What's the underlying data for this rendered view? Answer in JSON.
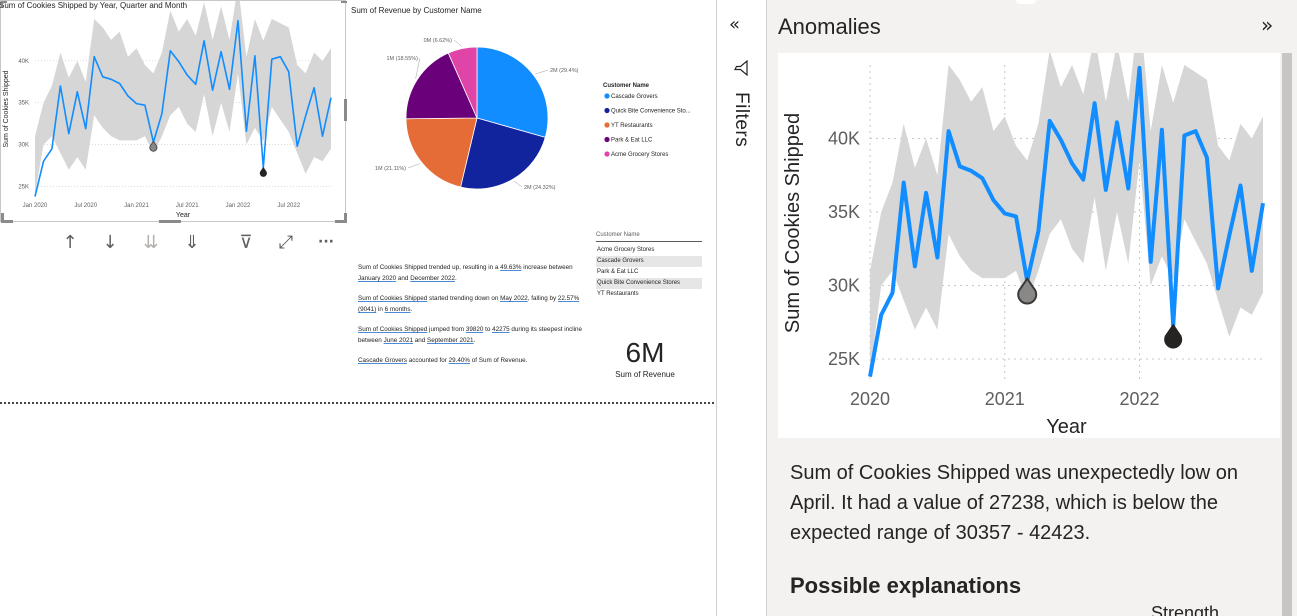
{
  "line_visual": {
    "title": "Sum of Cookies Shipped by Year, Quarter and Month",
    "ylabel": "Sum of Cookies Shipped",
    "xlabel": "Year",
    "x_ticks": [
      "Jan 2020",
      "Jul 2020",
      "Jan 2021",
      "Jul 2021",
      "Jan 2022",
      "Jul 2022"
    ],
    "y_ticks": [
      "25K",
      "30K",
      "35K",
      "40K"
    ]
  },
  "toolbar": {
    "drill_up": "↑",
    "drill_down_on": "↓",
    "expand_next_level": "⇊",
    "expand_all": "⇓",
    "filter": "⊽",
    "focus_mode": "⤢",
    "more_options": "···"
  },
  "pie_visual": {
    "title": "Sum of Revenue by Customer Name",
    "legend_title": "Customer Name",
    "slices": [
      {
        "name": "Cascade Grovers",
        "label": "2M (29.4%)",
        "percent": 29.4,
        "color": "#118dff"
      },
      {
        "name": "Quick Bite Convenience Sto...",
        "label": "2M (24.32%)",
        "percent": 24.32,
        "color": "#12239e"
      },
      {
        "name": "YT Restaurants",
        "label": "1M (21.11%)",
        "percent": 21.11,
        "color": "#e66c37"
      },
      {
        "name": "Park & Eat LLC",
        "label": "1M (18.55%)",
        "percent": 18.55,
        "color": "#6b007b"
      },
      {
        "name": "Acme Grocery Stores",
        "label": "0M (6.62%)",
        "percent": 6.62,
        "color": "#e044a7"
      }
    ]
  },
  "narrative": {
    "p1": {
      "a": "Sum of Cookies Shipped trended up, resulting in a ",
      "b": "49.63%",
      "c": " increase between ",
      "d": "January 2020",
      "e": " and ",
      "f": "December 2022",
      "g": "."
    },
    "p2": {
      "a": "Sum of Cookies Shipped",
      "b": " started trending down on ",
      "c": "May 2022",
      "d": ", falling by ",
      "e": "22.57% (9041)",
      "f": " in ",
      "g": "6 months",
      "h": "."
    },
    "p3": {
      "a": "Sum of Cookies Shipped",
      "b": " jumped from ",
      "c": "39820",
      "d": " to ",
      "e": "42275",
      "f": " during its steepest incline between ",
      "g": "June 2021",
      "h": " and ",
      "i": "September 2021",
      "j": "."
    },
    "p4": {
      "a": "Cascade Grovers",
      "b": " accounted for ",
      "c": "29.40%",
      "d": " of Sum of Revenue."
    }
  },
  "slicer": {
    "title": "Customer Name",
    "items": [
      {
        "label": "Acme Grocery Stores",
        "selected": false
      },
      {
        "label": "Cascade Grovers",
        "selected": true
      },
      {
        "label": "Park & Eat LLC",
        "selected": false
      },
      {
        "label": "Quick Bite Convenience Stores",
        "selected": true
      },
      {
        "label": "YT Restaurants",
        "selected": false
      }
    ]
  },
  "card": {
    "value": "6M",
    "label": "Sum of Revenue"
  },
  "filters_pane": {
    "collapse": "«",
    "label": "Filters"
  },
  "anomalies_pane": {
    "title": "Anomalies",
    "expand": "»",
    "description": "Sum of Cookies Shipped was unexpectedly low on April. It had a value of 27238, which is below the expected range of 30357 - 42423.",
    "possible_explanations": "Possible explanations",
    "partial_text": "Strength"
  },
  "chart_data": [
    {
      "type": "line",
      "title": "Sum of Cookies Shipped by Year, Quarter and Month",
      "xlabel": "Year",
      "ylabel": "Sum of Cookies Shipped",
      "x": [
        "2020-01",
        "2020-02",
        "2020-03",
        "2020-04",
        "2020-05",
        "2020-06",
        "2020-07",
        "2020-08",
        "2020-09",
        "2020-10",
        "2020-11",
        "2020-12",
        "2021-01",
        "2021-02",
        "2021-03",
        "2021-04",
        "2021-05",
        "2021-06",
        "2021-07",
        "2021-08",
        "2021-09",
        "2021-10",
        "2021-11",
        "2021-12",
        "2022-01",
        "2022-02",
        "2022-03",
        "2022-04",
        "2022-05",
        "2022-06",
        "2022-07",
        "2022-08",
        "2022-09",
        "2022-10",
        "2022-11",
        "2022-12"
      ],
      "series": [
        {
          "values": [
            23800,
            28000,
            29500,
            37000,
            31300,
            36300,
            31900,
            40500,
            38100,
            37800,
            37300,
            35800,
            34900,
            34700,
            30300,
            33700,
            41200,
            39900,
            38300,
            37200,
            42400,
            36500,
            41100,
            36600,
            44800,
            31600,
            40600,
            27238,
            40200,
            40500,
            38700,
            29800,
            33400,
            36800,
            31000,
            35600
          ]
        }
      ],
      "expected_range": {
        "lower": [
          24000,
          30000,
          31000,
          29000,
          27000,
          28500,
          27000,
          33500,
          32000,
          31000,
          30500,
          30500,
          30500,
          31000,
          29000,
          31000,
          33500,
          34500,
          32500,
          31500,
          36000,
          31000,
          35000,
          31500,
          38500,
          30000,
          32000,
          30357,
          34500,
          33000,
          31500,
          29000,
          26500,
          28500,
          28000,
          29500
        ],
        "upper": [
          31000,
          35000,
          37000,
          41000,
          38000,
          40000,
          37500,
          45000,
          44000,
          42500,
          43500,
          40500,
          41500,
          39500,
          38500,
          41000,
          46000,
          43500,
          45000,
          43000,
          47000,
          42500,
          46500,
          42500,
          49000,
          40500,
          45000,
          42423,
          45000,
          44500,
          44000,
          39500,
          38500,
          41000,
          40000,
          41500
        ]
      },
      "anomalies": [
        {
          "x": "2021-03",
          "value": 30300
        },
        {
          "x": "2022-04",
          "value": 27238
        }
      ],
      "ylim": [
        23500,
        45000
      ],
      "x_ticks": [
        "Jan 2020",
        "Jul 2020",
        "Jan 2021",
        "Jul 2021",
        "Jan 2022",
        "Jul 2022"
      ],
      "y_ticks": [
        "25K",
        "30K",
        "35K",
        "40K"
      ]
    },
    {
      "type": "pie",
      "title": "Sum of Revenue by Customer Name",
      "categories": [
        "Cascade Grovers",
        "Quick Bite Convenience Sto...",
        "YT Restaurants",
        "Park & Eat LLC",
        "Acme Grocery Stores"
      ],
      "values": [
        29.4,
        24.32,
        21.11,
        18.55,
        6.62
      ],
      "labels": [
        "2M (29.4%)",
        "2M (24.32%)",
        "1M (21.11%)",
        "1M (18.55%)",
        "0M (6.62%)"
      ],
      "legend": "right"
    },
    {
      "type": "line",
      "title": "Anomalies",
      "xlabel": "Year",
      "ylabel": "Sum of Cookies Shipped",
      "x_ticks": [
        "2020",
        "2021",
        "2022"
      ],
      "y_ticks": [
        "25K",
        "30K",
        "35K",
        "40K"
      ],
      "ylim": [
        23500,
        45000
      ]
    }
  ]
}
